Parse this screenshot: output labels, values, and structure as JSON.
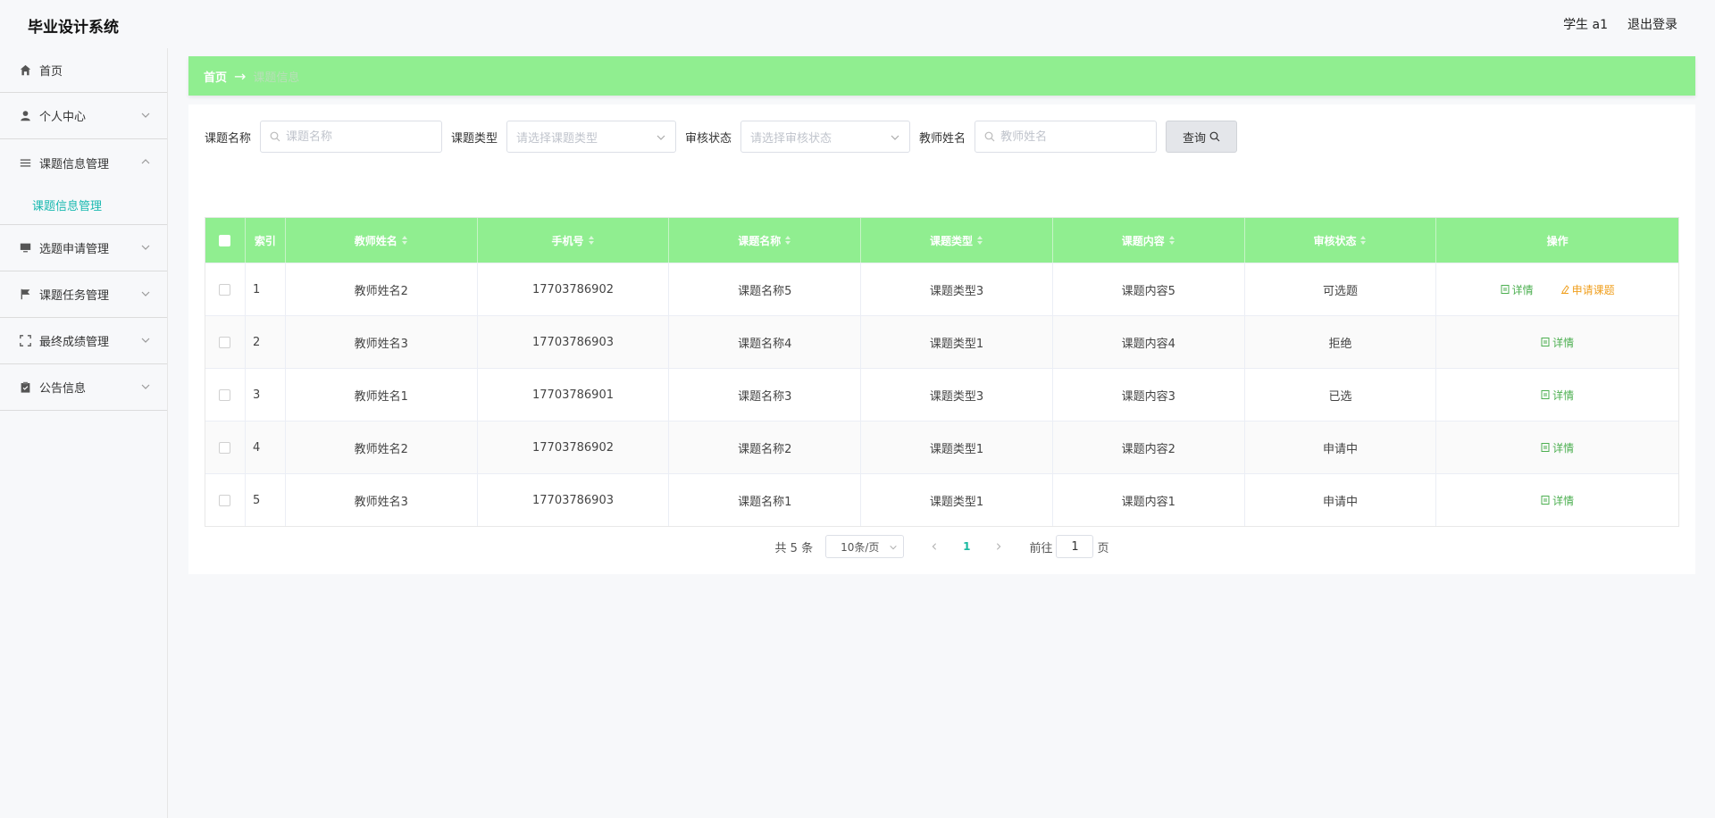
{
  "header": {
    "app_title": "毕业设计系统",
    "user_label": "学生 a1",
    "logout_label": "退出登录"
  },
  "sidebar": {
    "items": [
      {
        "label": "首页",
        "icon": "home-icon"
      },
      {
        "label": "个人中心",
        "icon": "user-icon"
      },
      {
        "label": "课题信息管理",
        "icon": "list-icon",
        "sub": "课题信息管理"
      },
      {
        "label": "选题申请管理",
        "icon": "monitor-icon"
      },
      {
        "label": "课题任务管理",
        "icon": "flag-icon"
      },
      {
        "label": "最终成绩管理",
        "icon": "fullscreen-icon"
      },
      {
        "label": "公告信息",
        "icon": "clipboard-icon"
      }
    ]
  },
  "breadcrumb": {
    "home": "首页",
    "current": "课题信息"
  },
  "search": {
    "name_label": "课题名称",
    "name_placeholder": "课题名称",
    "type_label": "课题类型",
    "type_placeholder": "请选择课题类型",
    "status_label": "审核状态",
    "status_placeholder": "请选择审核状态",
    "teacher_label": "教师姓名",
    "teacher_placeholder": "教师姓名",
    "query_label": "查询"
  },
  "table": {
    "headers": [
      "索引",
      "教师姓名",
      "手机号",
      "课题名称",
      "课题类型",
      "课题内容",
      "审核状态",
      "操作"
    ],
    "rows": [
      {
        "index": "1",
        "teacher": "教师姓名2",
        "phone": "17703786902",
        "name": "课题名称5",
        "type": "课题类型3",
        "content": "课题内容5",
        "status": "可选题",
        "can_apply": true
      },
      {
        "index": "2",
        "teacher": "教师姓名3",
        "phone": "17703786903",
        "name": "课题名称4",
        "type": "课题类型1",
        "content": "课题内容4",
        "status": "拒绝",
        "can_apply": false
      },
      {
        "index": "3",
        "teacher": "教师姓名1",
        "phone": "17703786901",
        "name": "课题名称3",
        "type": "课题类型3",
        "content": "课题内容3",
        "status": "已选",
        "can_apply": false
      },
      {
        "index": "4",
        "teacher": "教师姓名2",
        "phone": "17703786902",
        "name": "课题名称2",
        "type": "课题类型1",
        "content": "课题内容2",
        "status": "申请中",
        "can_apply": false
      },
      {
        "index": "5",
        "teacher": "教师姓名3",
        "phone": "17703786903",
        "name": "课题名称1",
        "type": "课题类型1",
        "content": "课题内容1",
        "status": "申请中",
        "can_apply": false
      }
    ],
    "detail_label": "详情",
    "apply_label": "申请课题"
  },
  "pagination": {
    "total": "共 5 条",
    "page_size": "10条/页",
    "current_page": "1",
    "goto_prefix": "前往",
    "goto_value": "1",
    "goto_suffix": "页"
  },
  "colors": {
    "accent_green": "#90ee90",
    "submenu_teal": "#19b9b0",
    "apply_orange": "#f0a020"
  }
}
